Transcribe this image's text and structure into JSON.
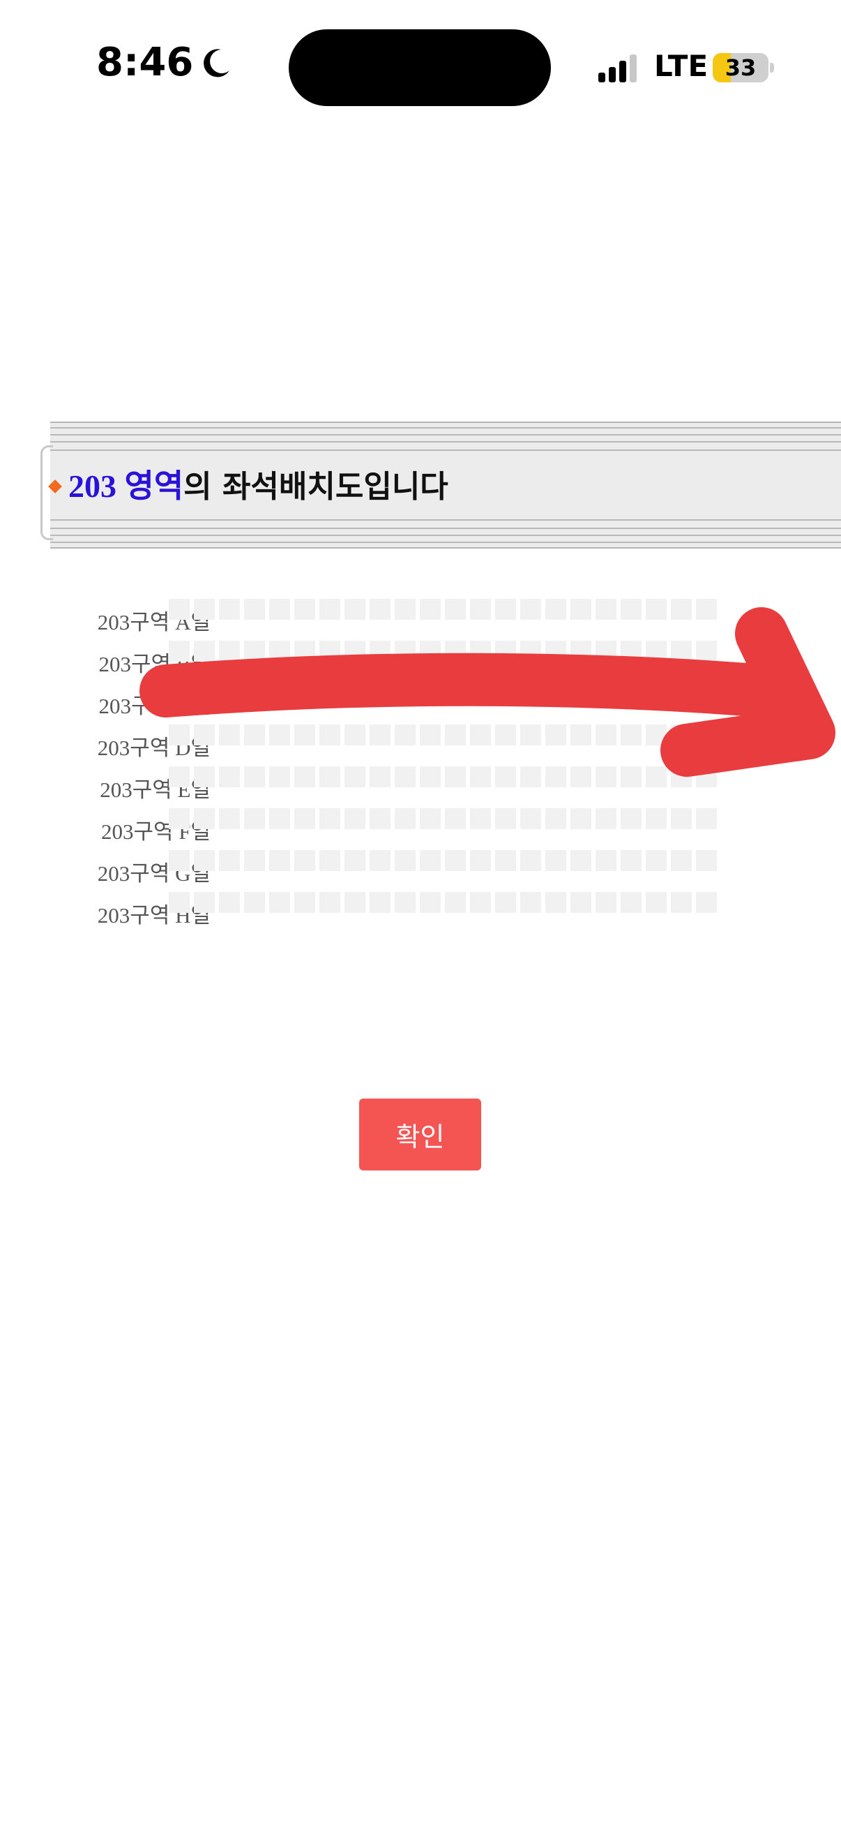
{
  "status_bar": {
    "time": "8:46",
    "network": "LTE",
    "battery_level": "33",
    "battery_fraction": 0.33
  },
  "header": {
    "title_highlight": "203 영역",
    "title_rest": "의 좌석배치도입니다"
  },
  "seat_rows": [
    {
      "label": "203구역 A열"
    },
    {
      "label": "203구역 B열"
    },
    {
      "label": "203구역 C열"
    },
    {
      "label": "203구역 D열"
    },
    {
      "label": "203구역 E열"
    },
    {
      "label": "203구역 F열"
    },
    {
      "label": "203구역 G열"
    },
    {
      "label": "203구역 H열"
    }
  ],
  "seats_per_row": 22,
  "confirm_button": {
    "label": "확인"
  },
  "colors": {
    "accent": "#f45553",
    "highlight_text": "#2b12d8",
    "arrow": "#e83c3e",
    "seat": "#f1f1f1"
  },
  "icons": [
    "moon-icon",
    "signal-icon",
    "battery-icon",
    "diamond-icon",
    "arrow-annotation"
  ]
}
